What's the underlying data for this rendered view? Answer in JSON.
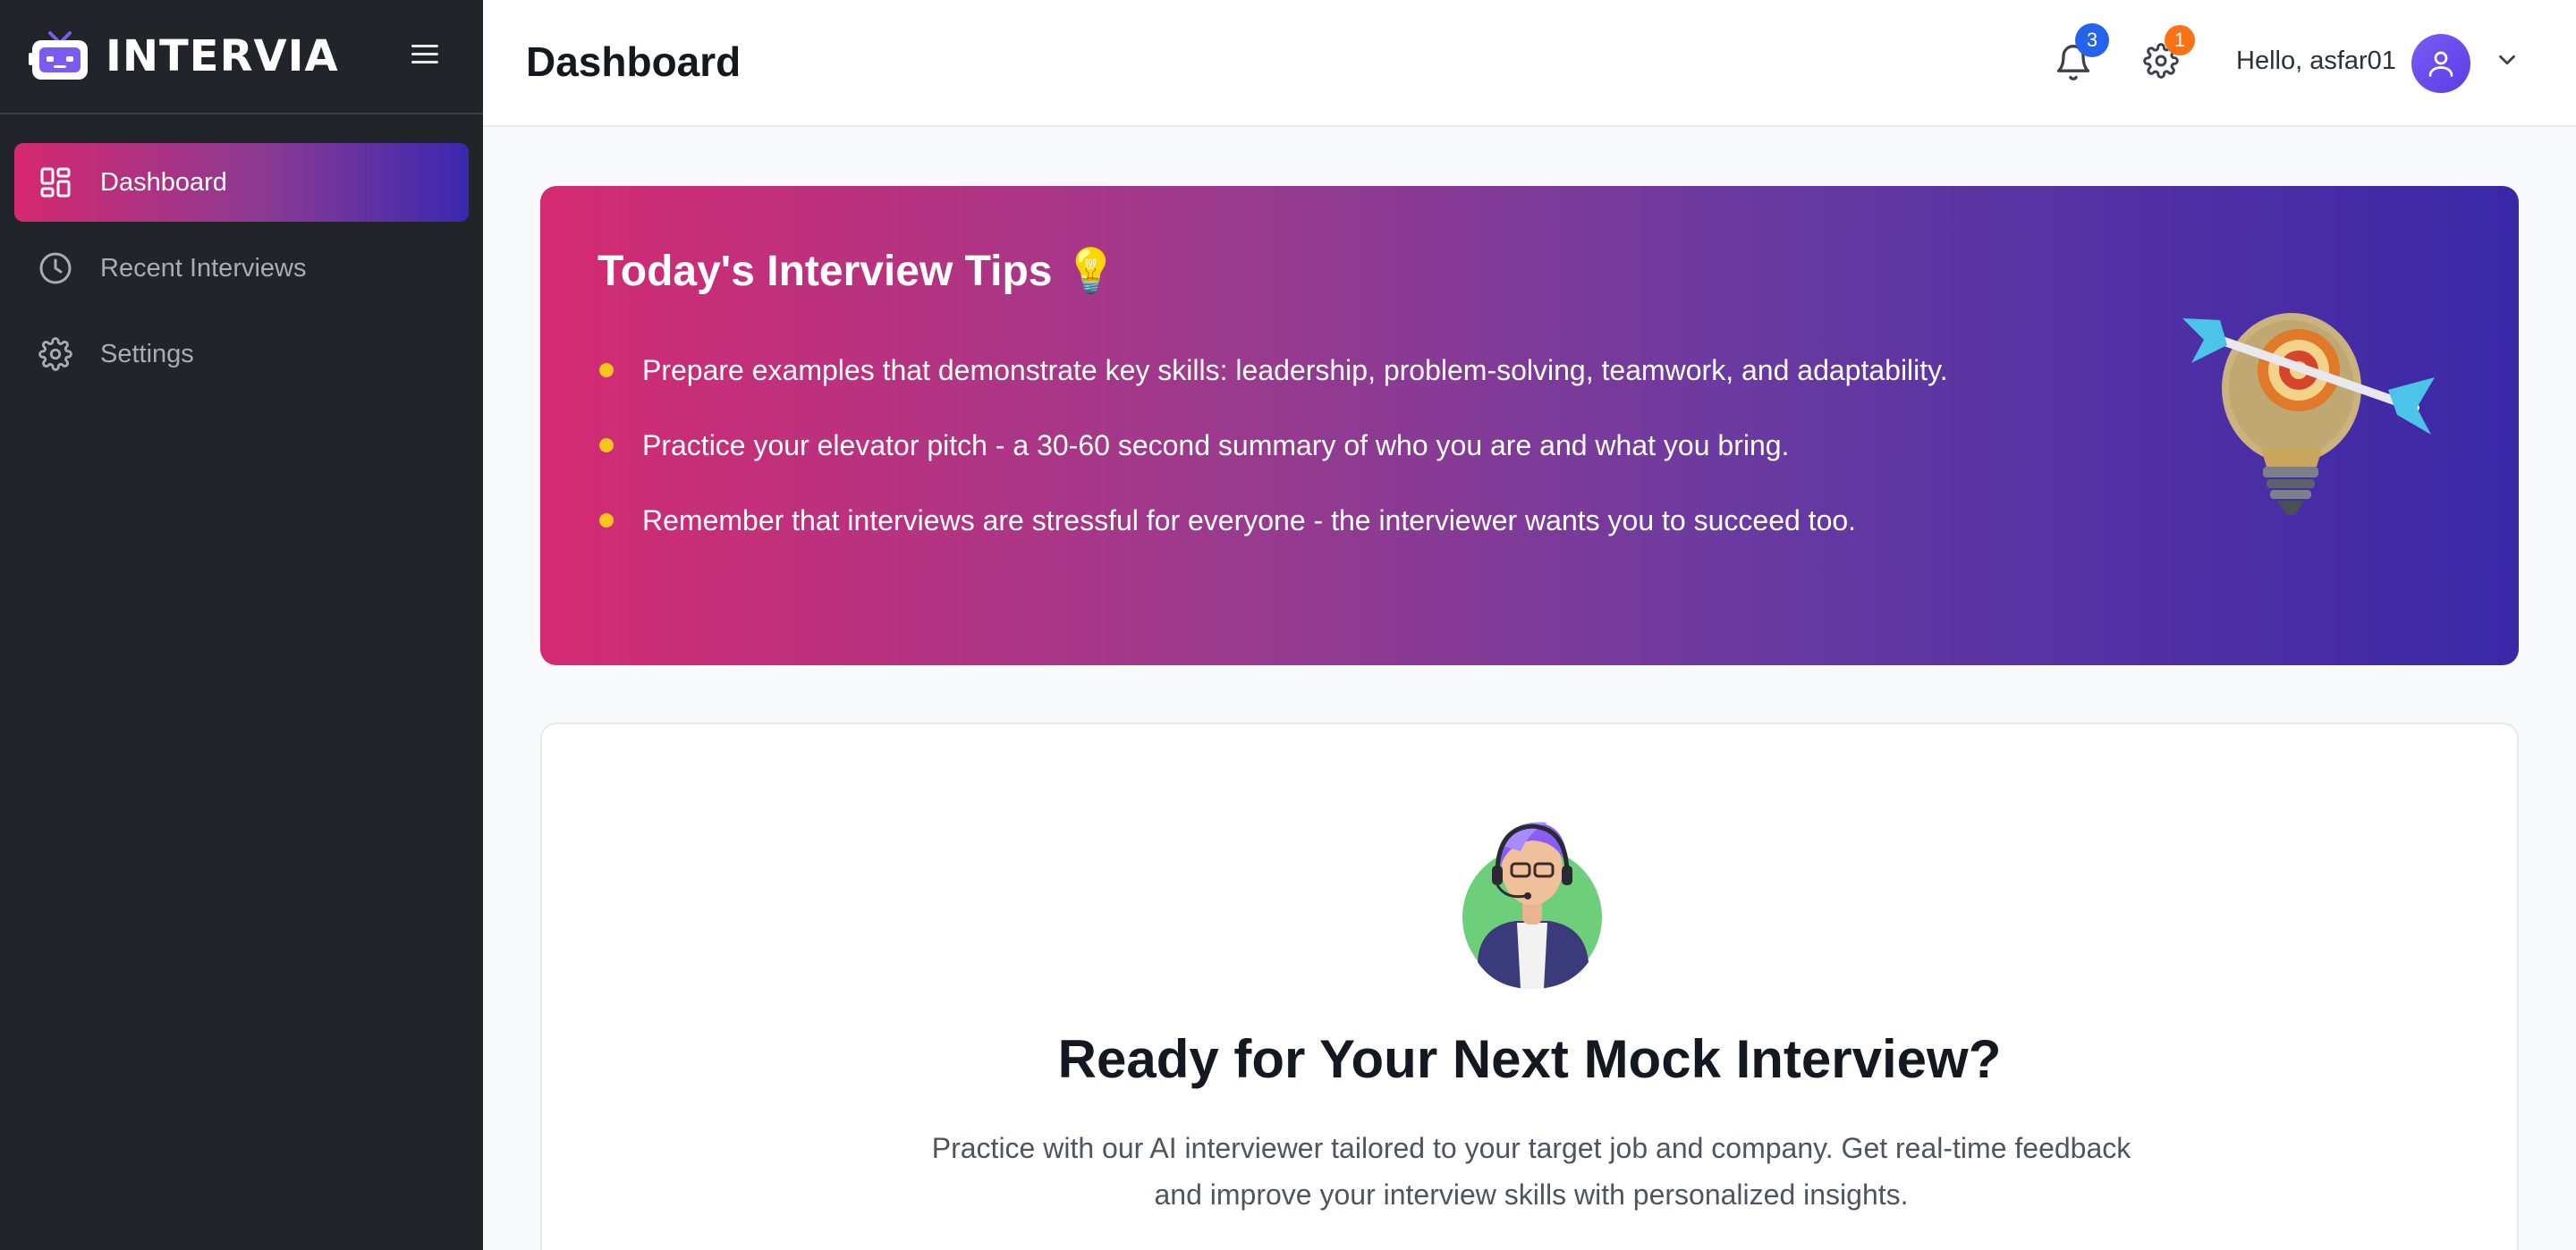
{
  "app": {
    "brand_name": "INTERVIA"
  },
  "sidebar": {
    "items": [
      {
        "label": "Dashboard",
        "icon": "dashboard-icon",
        "active": true
      },
      {
        "label": "Recent Interviews",
        "icon": "clock-icon",
        "active": false
      },
      {
        "label": "Settings",
        "icon": "gear-icon",
        "active": false
      }
    ]
  },
  "header": {
    "title": "Dashboard",
    "notifications_count": "3",
    "settings_count": "1",
    "greeting": "Hello, asfar01"
  },
  "tips": {
    "title": "Today's Interview Tips 💡",
    "items": [
      "Prepare examples that demonstrate key skills: leadership, problem-solving, teamwork, and adaptability.",
      "Practice your elevator pitch - a 30-60 second summary of who you are and what you bring.",
      "Remember that interviews are stressful for everyone - the interviewer wants you to succeed too."
    ]
  },
  "mock": {
    "title": "Ready for Your Next Mock Interview?",
    "description": "Practice with our AI interviewer tailored to your target job and company. Get real-time feedback and improve your interview skills with personalized insights."
  },
  "colors": {
    "sidebar_bg": "#212529",
    "accent_pink": "#d6286f",
    "accent_indigo": "#3a28b0",
    "bell_badge": "#2563eb",
    "settings_badge": "#f97316",
    "bullet": "#f7c51b"
  }
}
